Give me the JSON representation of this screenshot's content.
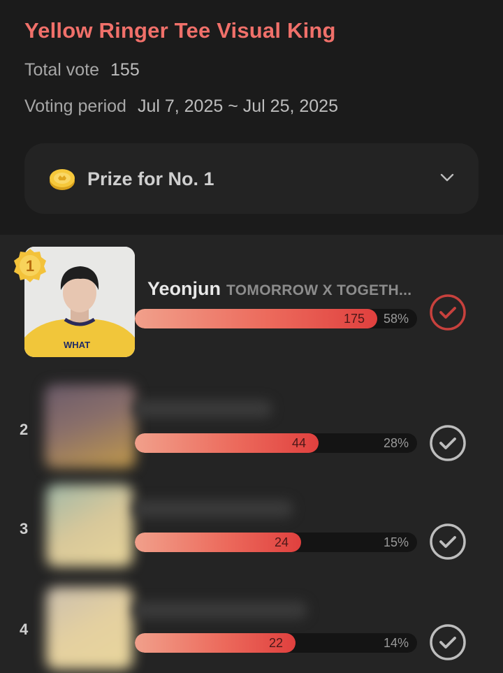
{
  "poll": {
    "title": "Yellow Ringer Tee Visual King",
    "total_vote_label": "Total vote",
    "total_vote_value": "155",
    "period_label": "Voting period",
    "period_value": "Jul 7, 2025 ~ Jul 25, 2025"
  },
  "prize": {
    "label": "Prize for No. 1",
    "icon": "coin-icon",
    "expand_icon": "chevron-down-icon"
  },
  "candidates": [
    {
      "rank": "1",
      "badge": "1",
      "name": "Yeonjun",
      "group": "TOMORROW X TOGETH...",
      "votes": "175",
      "percent": "58%",
      "fill_fraction": 0.86,
      "selected_color": "#c7413d"
    },
    {
      "rank": "2",
      "votes": "44",
      "percent": "28%",
      "fill_fraction": 0.65
    },
    {
      "rank": "3",
      "votes": "24",
      "percent": "15%",
      "fill_fraction": 0.59
    },
    {
      "rank": "4",
      "votes": "22",
      "percent": "14%",
      "fill_fraction": 0.57
    }
  ],
  "colors": {
    "title": "#f0706a",
    "bar_start": "#f1a08b",
    "bar_end": "#e0403e",
    "check_default": "#bdbdbd",
    "check_top": "#c7413d",
    "badge": "#f3c23a"
  }
}
